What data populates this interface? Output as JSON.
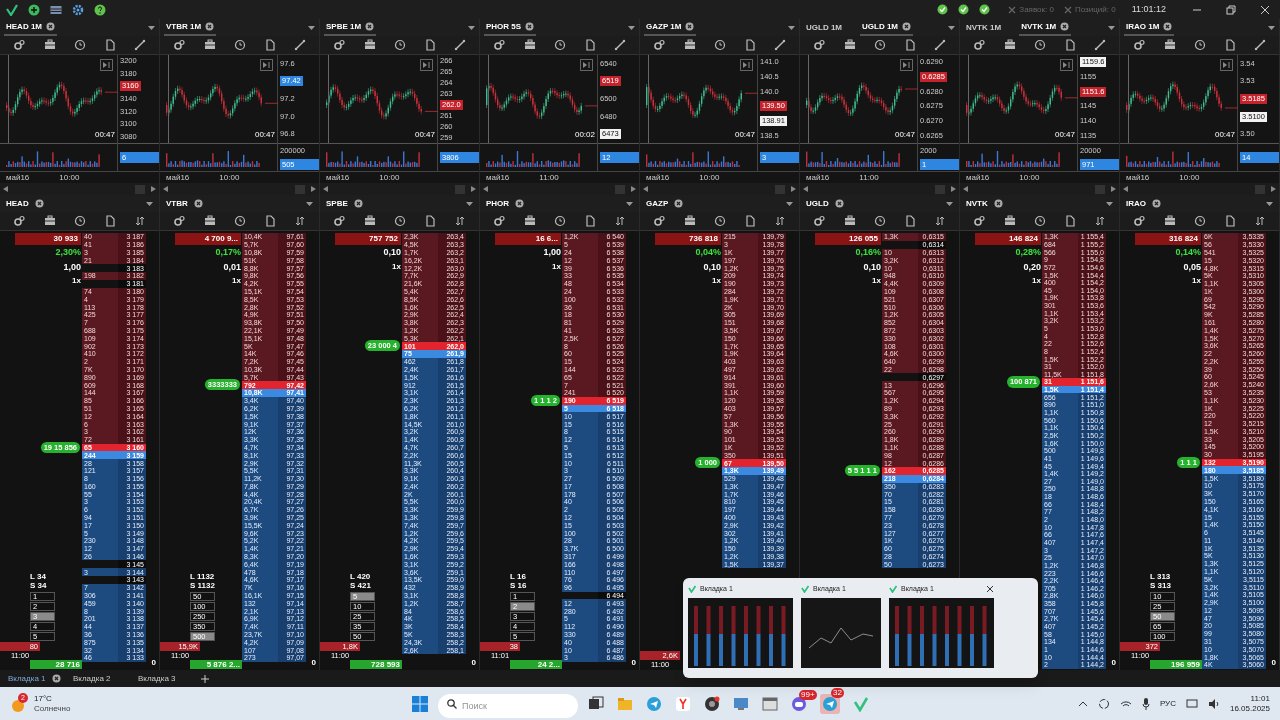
{
  "top_bar": {
    "orders": "Заявок: 0",
    "positions": "Позиций: 0",
    "clock": "11:01:12"
  },
  "chart_panels": [
    {
      "tabs": [
        {
          "label": "HEAD 1M",
          "selected": true
        }
      ],
      "axis": [
        {
          "text": "3200",
          "kind": "tick"
        },
        {
          "text": "3180",
          "kind": "tick"
        },
        {
          "text": "3160",
          "kind": "last"
        },
        {
          "text": "3140",
          "kind": "tick"
        },
        {
          "text": "3120",
          "kind": "tick"
        },
        {
          "text": "3100",
          "kind": "tick"
        },
        {
          "text": "3080",
          "kind": "tick"
        }
      ],
      "timer": "00:47",
      "volume_tag": "6",
      "x_labels": [
        "май16",
        "10:00"
      ]
    },
    {
      "tabs": [
        {
          "label": "VTBR 1M",
          "selected": true
        }
      ],
      "axis": [
        {
          "text": "97.6",
          "kind": "tick"
        },
        {
          "text": "97.42",
          "kind": "bid"
        },
        {
          "text": "97.2",
          "kind": "tick"
        },
        {
          "text": "97.0",
          "kind": "tick"
        },
        {
          "text": "96.8",
          "kind": "tick"
        }
      ],
      "timer": "00:47",
      "volume_tick": "200000",
      "volume_tag": "505",
      "x_labels": [
        "май16",
        "10:00"
      ]
    },
    {
      "tabs": [
        {
          "label": "SPBE 1M",
          "selected": true
        }
      ],
      "axis": [
        {
          "text": "266",
          "kind": "tick"
        },
        {
          "text": "265",
          "kind": "tick"
        },
        {
          "text": "264",
          "kind": "tick"
        },
        {
          "text": "263",
          "kind": "tick"
        },
        {
          "text": "262.0",
          "kind": "last"
        },
        {
          "text": "261",
          "kind": "tick"
        },
        {
          "text": "260",
          "kind": "tick"
        },
        {
          "text": "259",
          "kind": "tick"
        }
      ],
      "timer": "00:47",
      "volume_tag": "3806",
      "x_labels": [
        "май16",
        "10:00"
      ]
    },
    {
      "tabs": [
        {
          "label": "PHOR 5S",
          "selected": true
        }
      ],
      "axis": [
        {
          "text": "6540",
          "kind": "tick"
        },
        {
          "text": "6519",
          "kind": "last"
        },
        {
          "text": "6500",
          "kind": "tick"
        },
        {
          "text": "6480",
          "kind": "tick"
        },
        {
          "text": "6473",
          "kind": "level"
        }
      ],
      "timer": "00:02",
      "volume_tag": "12",
      "x_labels": [
        "май16",
        "11:00"
      ]
    },
    {
      "tabs": [
        {
          "label": "GAZP 1M",
          "selected": true
        }
      ],
      "axis": [
        {
          "text": "141.0",
          "kind": "tick"
        },
        {
          "text": "140.5",
          "kind": "tick"
        },
        {
          "text": "140.0",
          "kind": "tick"
        },
        {
          "text": "139.50",
          "kind": "last"
        },
        {
          "text": "138.91",
          "kind": "level"
        },
        {
          "text": "138.5",
          "kind": "tick"
        }
      ],
      "timer": "00:47",
      "volume_tag": "3",
      "x_labels": [
        "май16",
        "10:00"
      ]
    },
    {
      "tabs": [
        {
          "label": "UGLD 1M",
          "selected": false
        },
        {
          "label": "UGLD 1M",
          "selected": true
        }
      ],
      "axis": [
        {
          "text": "0.6290",
          "kind": "tick"
        },
        {
          "text": "0.6285",
          "kind": "last"
        },
        {
          "text": "0.6280",
          "kind": "tick"
        },
        {
          "text": "0.6275",
          "kind": "tick"
        },
        {
          "text": "0.6270",
          "kind": "tick"
        },
        {
          "text": "0.6265",
          "kind": "tick"
        }
      ],
      "timer": "00:47",
      "volume_tick": "2000",
      "volume_tag": "1",
      "x_labels": [
        "май16",
        "11:00"
      ]
    },
    {
      "tabs": [
        {
          "label": "NVTK 1M",
          "selected": false
        },
        {
          "label": "NVTK 1M",
          "selected": true
        }
      ],
      "axis": [
        {
          "text": "1159.6",
          "kind": "level"
        },
        {
          "text": "1155",
          "kind": "tick"
        },
        {
          "text": "1151.6",
          "kind": "last"
        },
        {
          "text": "1145",
          "kind": "tick"
        },
        {
          "text": "1140",
          "kind": "tick"
        },
        {
          "text": "1135",
          "kind": "tick"
        }
      ],
      "timer": "00:47",
      "volume_tick": "20000",
      "volume_tag": "971",
      "x_labels": [
        "май16",
        "10:00"
      ]
    },
    {
      "tabs": [
        {
          "label": "IRAO 1M",
          "selected": true
        }
      ],
      "axis": [
        {
          "text": "3.54",
          "kind": "tick"
        },
        {
          "text": "3.53",
          "kind": "tick"
        },
        {
          "text": "3.5185",
          "kind": "last"
        },
        {
          "text": "3.5100",
          "kind": "level"
        },
        {
          "text": "3.50",
          "kind": "tick"
        }
      ],
      "timer": "00:47",
      "volume_tag": "14",
      "x_labels": [
        "май16",
        "10:00"
      ]
    }
  ],
  "order_books": [
    {
      "ticker": "HEAD",
      "volume": "30 933",
      "change": "2,30%",
      "step": "1,00",
      "multiplier": "1x",
      "marker": "19 15 856",
      "asks": [
        [
          "40",
          "3 187"
        ],
        [
          "41",
          "3 186"
        ],
        [
          "3",
          "3 185"
        ],
        [
          "21",
          "3 184"
        ],
        [
          "3 183"
        ],
        [
          "198",
          "3 182"
        ],
        [
          "3 181"
        ],
        [
          "74",
          "3 180"
        ],
        [
          "4",
          "3 179"
        ],
        [
          "113",
          "3 178"
        ],
        [
          "425",
          "3 177"
        ],
        [
          "7",
          "3 176"
        ],
        [
          "688",
          "3 175"
        ],
        [
          "109",
          "3 174"
        ],
        [
          "902",
          "3 173"
        ],
        [
          "410",
          "3 172"
        ],
        [
          "2",
          "3 171"
        ],
        [
          "7K",
          "3 170"
        ],
        [
          "890",
          "3 169"
        ],
        [
          "609",
          "3 168"
        ],
        [
          "144",
          "3 167"
        ],
        [
          "85",
          "3 166"
        ],
        [
          "51",
          "3 165"
        ],
        [
          "12",
          "3 164"
        ],
        [
          "6",
          "3 163"
        ],
        [
          "3",
          "3 162"
        ],
        [
          "72",
          "3 161"
        ]
      ],
      "best_ask": [
        "65",
        "3 160"
      ],
      "best_bid": [
        "244",
        "3 159"
      ],
      "bids": [
        [
          "28",
          "3 158"
        ],
        [
          "121",
          "3 157"
        ],
        [
          "8",
          "3 156"
        ],
        [
          "160",
          "3 155"
        ],
        [
          "55",
          "3 154"
        ],
        [
          "3",
          "3 153"
        ],
        [
          "6",
          "3 152"
        ],
        [
          "94",
          "3 151"
        ],
        [
          "17",
          "3 150"
        ],
        [
          "5",
          "3 149"
        ],
        [
          "230",
          "3 148"
        ],
        [
          "12",
          "3 147"
        ],
        [
          "26",
          "3 146"
        ],
        [
          "3 145"
        ],
        [
          "3",
          "3 144"
        ],
        [
          "3 143"
        ],
        [
          "7",
          "3 142"
        ],
        [
          "306",
          "3 141"
        ],
        [
          "459",
          "3 140"
        ],
        [
          "8",
          "3 139"
        ],
        [
          "201",
          "3 138"
        ],
        [
          "44",
          "3 137"
        ],
        [
          "36",
          "3 136"
        ],
        [
          "875",
          "3 135"
        ],
        [
          "32",
          "3 134"
        ],
        [
          "46",
          "3 133"
        ]
      ],
      "bottom": {
        "long": "L 34",
        "short": "S 34",
        "lots": [
          {
            "label": "1",
            "selected": false
          },
          {
            "label": "2",
            "selected": false
          },
          {
            "label": "3",
            "selected": true
          },
          {
            "label": "4",
            "selected": false
          },
          {
            "label": "5",
            "selected": false
          }
        ],
        "sell_tag": "80",
        "time": "11:00",
        "total": "28 716"
      },
      "zero": "0"
    },
    {
      "ticker": "VTBR",
      "volume": "4 700 9...",
      "change": "0,17%",
      "step": "0,01",
      "multiplier": "1x",
      "marker": "3333333",
      "asks": [
        [
          "10,4K",
          "97,61"
        ],
        [
          "5,7K",
          "97,60"
        ],
        [
          "10,8K",
          "97,59"
        ],
        [
          "51K",
          "97,58"
        ],
        [
          "8,8K",
          "97,57"
        ],
        [
          "9,8K",
          "97,56"
        ],
        [
          "4,2K",
          "97,55"
        ],
        [
          "15,1K",
          "97,54"
        ],
        [
          "8,5K",
          "97,53"
        ],
        [
          "2,8K",
          "97,52"
        ],
        [
          "4,9K",
          "97,51"
        ],
        [
          "93,8K",
          "97,50"
        ],
        [
          "22,1K",
          "97,49"
        ],
        [
          "15,1K",
          "97,48"
        ],
        [
          "5K",
          "97,47"
        ],
        [
          "14K",
          "97,46"
        ],
        [
          "7,2K",
          "97,45"
        ],
        [
          "10,3K",
          "97,44"
        ],
        [
          "5,7K",
          "97,43"
        ]
      ],
      "best_ask": [
        "792",
        "97,42"
      ],
      "best_bid": [
        "10,8K",
        "97,41"
      ],
      "bids": [
        [
          "3,4K",
          "97,40"
        ],
        [
          "6,2K",
          "97,39"
        ],
        [
          "1,5K",
          "97,38"
        ],
        [
          "9,1K",
          "97,37"
        ],
        [
          "12K",
          "97,36"
        ],
        [
          "3,3K",
          "97,35"
        ],
        [
          "4,7K",
          "97,34"
        ],
        [
          "8,1K",
          "97,33"
        ],
        [
          "2,9K",
          "97,32"
        ],
        [
          "5,5K",
          "97,31"
        ],
        [
          "11,2K",
          "97,30"
        ],
        [
          "7,8K",
          "97,29"
        ],
        [
          "4,4K",
          "97,28"
        ],
        [
          "20,4K",
          "97,27"
        ],
        [
          "6,7K",
          "97,26"
        ],
        [
          "3,9K",
          "97,25"
        ],
        [
          "15,5K",
          "97,24"
        ],
        [
          "9,6K",
          "97,23"
        ],
        [
          "5,2K",
          "97,22"
        ],
        [
          "1,4K",
          "97,21"
        ],
        [
          "8,3K",
          "97,20"
        ],
        [
          "6,4K",
          "97,19"
        ],
        [
          "478",
          "97,18"
        ],
        [
          "4,6K",
          "97,17"
        ],
        [
          "7K",
          "97,16"
        ],
        [
          "16,1K",
          "97,15"
        ],
        [
          "132",
          "97,14"
        ],
        [
          "2,1K",
          "97,13"
        ],
        [
          "6,9K",
          "97,12"
        ],
        [
          "7,4K",
          "97,11"
        ],
        [
          "23,7K",
          "97,10"
        ],
        [
          "4,2K",
          "97,09"
        ],
        [
          "107",
          "97,08"
        ],
        [
          "273",
          "97,07"
        ]
      ],
      "bottom": {
        "long": "L 1132",
        "short": "S 1132",
        "lots": [
          {
            "label": "50",
            "selected": false
          },
          {
            "label": "100",
            "selected": false
          },
          {
            "label": "250",
            "selected": false
          },
          {
            "label": "350",
            "selected": false
          },
          {
            "label": "500",
            "selected": true
          }
        ],
        "sell_tag": "15,9K",
        "time": "11:00",
        "total": "5 876 2..."
      },
      "zero": "0"
    },
    {
      "ticker": "SPBE",
      "volume": "757 752",
      "step": "0,10",
      "multiplier": "1x",
      "marker": "23 000 4",
      "asks": [
        [
          "2,3K",
          "263,4"
        ],
        [
          "4,5K",
          "263,3"
        ],
        [
          "1,7K",
          "263,2"
        ],
        [
          "16,2K",
          "263,1"
        ],
        [
          "12,2K",
          "263,0"
        ],
        [
          "7,7K",
          "262,9"
        ],
        [
          "21,6K",
          "262,8"
        ],
        [
          "5,4K",
          "262,7"
        ],
        [
          "8,5K",
          "262,6"
        ],
        [
          "1,6K",
          "262,5"
        ],
        [
          "2,9K",
          "262,4"
        ],
        [
          "3,8K",
          "262,3"
        ],
        [
          "1,2K",
          "262,2"
        ],
        [
          "5,3K",
          "262,1"
        ]
      ],
      "best_ask": [
        "101",
        "262,0"
      ],
      "best_bid": [
        "75",
        "261,9"
      ],
      "bids": [
        [
          "462",
          "261,8"
        ],
        [
          "2,4K",
          "261,7"
        ],
        [
          "1,5K",
          "261,6"
        ],
        [
          "912",
          "261,5"
        ],
        [
          "3,1K",
          "261,4"
        ],
        [
          "2,3K",
          "261,3"
        ],
        [
          "6,2K",
          "261,2"
        ],
        [
          "1,8K",
          "261,1"
        ],
        [
          "14,5K",
          "261,0"
        ],
        [
          "3,2K",
          "260,9"
        ],
        [
          "1,4K",
          "260,8"
        ],
        [
          "4,7K",
          "260,7"
        ],
        [
          "2,2K",
          "260,6"
        ],
        [
          "11,3K",
          "260,5"
        ],
        [
          "3,3K",
          "260,4"
        ],
        [
          "9,1K",
          "260,3"
        ],
        [
          "2,4K",
          "260,2"
        ],
        [
          "2K",
          "260,1"
        ],
        [
          "5,5K",
          "260,0"
        ],
        [
          "3,3K",
          "259,9"
        ],
        [
          "1,3K",
          "259,8"
        ],
        [
          "7,4K",
          "259,7"
        ],
        [
          "1,2K",
          "259,6"
        ],
        [
          "4,2K",
          "259,5"
        ],
        [
          "2,9K",
          "259,4"
        ],
        [
          "1,6K",
          "259,3"
        ],
        [
          "3,1K",
          "259,2"
        ],
        [
          "3,6K",
          "259,1"
        ],
        [
          "13,5K",
          "259,0"
        ],
        [
          "432",
          "258,9"
        ],
        [
          "3,1K",
          "258,8"
        ],
        [
          "1,2K",
          "258,7"
        ],
        [
          "84",
          "258,6"
        ],
        [
          "4K",
          "258,5"
        ],
        [
          "3K",
          "258,4"
        ],
        [
          "5K",
          "258,3"
        ],
        [
          "24,3K",
          "258,2"
        ],
        [
          "2,6K",
          "258,1"
        ]
      ],
      "bottom": {
        "long": "L 420",
        "short": "S 421",
        "lots": [
          {
            "label": "5",
            "selected": true
          },
          {
            "label": "10",
            "selected": false
          },
          {
            "label": "25",
            "selected": false
          },
          {
            "label": "35",
            "selected": false
          },
          {
            "label": "50",
            "selected": false
          }
        ],
        "sell_tag": "1,8K",
        "time": "11:00",
        "total": "728 593"
      },
      "zero": "0"
    },
    {
      "ticker": "PHOR",
      "volume": "16 6...",
      "step": "1,00",
      "multiplier": "1x",
      "marker": "1 1 1 2",
      "asks": [
        [
          "1,2K",
          "6 540"
        ],
        [
          "5",
          "6 539"
        ],
        [
          "24",
          "6 538"
        ],
        [
          "12",
          "6 537"
        ],
        [
          "39",
          "6 536"
        ],
        [
          "33",
          "6 535"
        ],
        [
          "48",
          "6 534"
        ],
        [
          "24",
          "6 533"
        ],
        [
          "100",
          "6 532"
        ],
        [
          "36",
          "6 531"
        ],
        [
          "18",
          "6 530"
        ],
        [
          "81",
          "6 529"
        ],
        [
          "41",
          "6 528"
        ],
        [
          "2,5K",
          "6 527"
        ],
        [
          "8",
          "6 526"
        ],
        [
          "60",
          "6 525"
        ],
        [
          "15",
          "6 524"
        ],
        [
          "144",
          "6 523"
        ],
        [
          "65",
          "6 522"
        ],
        [
          "7",
          "6 521"
        ],
        [
          "241",
          "6 520"
        ]
      ],
      "best_ask": [
        "190",
        "6 519"
      ],
      "best_bid": [
        "5",
        "6 518"
      ],
      "bids": [
        [
          "10",
          "6 517"
        ],
        [
          "15",
          "6 516"
        ],
        [
          "8",
          "6 515"
        ],
        [
          "12",
          "6 514"
        ],
        [
          "5",
          "6 513"
        ],
        [
          "15",
          "6 512"
        ],
        [
          "10",
          "6 511"
        ],
        [
          "3",
          "6 510"
        ],
        [
          "27",
          "6 509"
        ],
        [
          "17",
          "6 508"
        ],
        [
          "178",
          "6 507"
        ],
        [
          "40",
          "6 506"
        ],
        [
          "2",
          "6 505"
        ],
        [
          "12",
          "6 504"
        ],
        [
          "15",
          "6 503"
        ],
        [
          "100",
          "6 502"
        ],
        [
          "28",
          "6 501"
        ],
        [
          "3,7K",
          "6 500"
        ],
        [
          "317",
          "6 499"
        ],
        [
          "166",
          "6 498"
        ],
        [
          "110",
          "6 497"
        ],
        [
          "76",
          "6 496"
        ],
        [
          "96",
          "6 495"
        ],
        [
          "6 494"
        ],
        [
          "12",
          "6 493"
        ],
        [
          "280",
          "6 492"
        ],
        [
          "5",
          "6 491"
        ],
        [
          "112",
          "6 490"
        ],
        [
          "330",
          "6 489"
        ],
        [
          "40",
          "6 488"
        ],
        [
          "10",
          "6 487"
        ],
        [
          "3",
          "6 486"
        ]
      ],
      "bottom": {
        "long": "L 16",
        "short": "S 16",
        "lots": [
          {
            "label": "1",
            "selected": false
          },
          {
            "label": "2",
            "selected": true
          },
          {
            "label": "3",
            "selected": false
          },
          {
            "label": "4",
            "selected": false
          },
          {
            "label": "5",
            "selected": false
          }
        ],
        "sell_tag": "38",
        "time": "11:01",
        "total": "24 2..."
      },
      "zero": "0"
    },
    {
      "ticker": "GAZP",
      "volume": "736 818",
      "change": "0,04%",
      "step": "0,10",
      "multiplier": "1x",
      "marker": "1 000",
      "asks": [
        [
          "215",
          "139,79"
        ],
        [
          "3",
          "139,78"
        ],
        [
          "1K",
          "139,77"
        ],
        [
          "197",
          "139,76"
        ],
        [
          "1,2K",
          "139,75"
        ],
        [
          "209",
          "139,74"
        ],
        [
          "190",
          "139,73"
        ],
        [
          "284",
          "139,72"
        ],
        [
          "1,9K",
          "139,71"
        ],
        [
          "2K",
          "139,70"
        ],
        [
          "305",
          "139,69"
        ],
        [
          "151",
          "139,68"
        ],
        [
          "3,5K",
          "139,67"
        ],
        [
          "150",
          "139,66"
        ],
        [
          "1,7K",
          "139,65"
        ],
        [
          "1,9K",
          "139,64"
        ],
        [
          "403",
          "139,63"
        ],
        [
          "497",
          "139,62"
        ],
        [
          "914",
          "139,61"
        ],
        [
          "391",
          "139,60"
        ],
        [
          "1,1K",
          "139,59"
        ],
        [
          "120",
          "139,58"
        ],
        [
          "403",
          "139,57"
        ],
        [
          "57",
          "139,56"
        ],
        [
          "1,3K",
          "139,55"
        ],
        [
          "90",
          "139,54"
        ],
        [
          "101",
          "139,53"
        ],
        [
          "1K",
          "139,52"
        ],
        [
          "350",
          "139,51"
        ]
      ],
      "best_ask": [
        "67",
        "139,50"
      ],
      "best_bid": [
        "1,3K",
        "139,49"
      ],
      "bids": [
        [
          "529",
          "139,48"
        ],
        [
          "1,3K",
          "139,47"
        ],
        [
          "1,7K",
          "139,46"
        ],
        [
          "810",
          "139,45"
        ],
        [
          "197",
          "139,44"
        ],
        [
          "400",
          "139,43"
        ],
        [
          "2,9K",
          "139,42"
        ],
        [
          "302",
          "139,41"
        ],
        [
          "1,2K",
          "139,40"
        ],
        [
          "150",
          "139,39"
        ],
        [
          "1,2K",
          "139,38"
        ],
        [
          "1,5K",
          "139,37"
        ]
      ],
      "bottom": {
        "sell_tag": "2,6K",
        "time": "11:00"
      }
    },
    {
      "ticker": "UGLD",
      "volume": "126 055",
      "change": "0,16%",
      "step": "0,10",
      "multiplier": "1x",
      "marker": "5 5 1 1 1",
      "asks": [
        [
          "1,3K",
          "0,6315"
        ],
        [
          "0,6314"
        ],
        [
          "10",
          "0,6313"
        ],
        [
          "3,2K",
          "0,6312"
        ],
        [
          "10",
          "0,6311"
        ],
        [
          "948",
          "0,6310"
        ],
        [
          "4,4K",
          "0,6309"
        ],
        [
          "109",
          "0,6308"
        ],
        [
          "521",
          "0,6307"
        ],
        [
          "510",
          "0,6306"
        ],
        [
          "1,2K",
          "0,6305"
        ],
        [
          "852",
          "0,6304"
        ],
        [
          "872",
          "0,6303"
        ],
        [
          "330",
          "0,6302"
        ],
        [
          "108",
          "0,6301"
        ],
        [
          "4,6K",
          "0,6300"
        ],
        [
          "640",
          "0,6299"
        ],
        [
          "22",
          "0,6298"
        ],
        [
          "0,6297"
        ],
        [
          "13",
          "0,6296"
        ],
        [
          "567",
          "0,6295"
        ],
        [
          "1,2K",
          "0,6294"
        ],
        [
          "89",
          "0,6293"
        ],
        [
          "3,3K",
          "0,6292"
        ],
        [
          "25",
          "0,6291"
        ],
        [
          "260",
          "0,6290"
        ],
        [
          "1,8K",
          "0,6289"
        ],
        [
          "1,1K",
          "0,6288"
        ],
        [
          "98",
          "0,6287"
        ],
        [
          "12",
          "0,6286"
        ]
      ],
      "best_ask": [
        "162",
        "0,6285"
      ],
      "best_bid": [
        "218",
        "0,6284"
      ],
      "bids": [
        [
          "350",
          "0,6283"
        ],
        [
          "70",
          "0,6282"
        ],
        [
          "15",
          "0,6281"
        ],
        [
          "158",
          "0,6280"
        ],
        [
          "77",
          "0,6279"
        ],
        [
          "23",
          "0,6278"
        ],
        [
          "127",
          "0,6277"
        ],
        [
          "1K",
          "0,6276"
        ],
        [
          "60",
          "0,6275"
        ],
        [
          "28",
          "0,6274"
        ],
        [
          "50",
          "0,6273"
        ]
      ]
    },
    {
      "ticker": "NVTK",
      "volume": "146 824",
      "change": "0,28%",
      "step": "0,20",
      "multiplier": "1x",
      "marker": "100 871",
      "asks": [
        [
          "1,3K",
          "1 155,4"
        ],
        [
          "684",
          "1 155,2"
        ],
        [
          "566",
          "1 155,0"
        ],
        [
          "9",
          "1 154,8"
        ],
        [
          "572",
          "1 154,6"
        ],
        [
          "1,5K",
          "1 154,4"
        ],
        [
          "400",
          "1 154,2"
        ],
        [
          "45",
          "1 154,0"
        ],
        [
          "1,9K",
          "1 153,8"
        ],
        [
          "301",
          "1 153,6"
        ],
        [
          "1,1K",
          "1 153,4"
        ],
        [
          "3,2K",
          "1 153,2"
        ],
        [
          "5",
          "1 153,0"
        ],
        [
          "4",
          "1 152,8"
        ],
        [
          "22",
          "1 152,6"
        ],
        [
          "8",
          "1 152,4"
        ],
        [
          "1,5K",
          "1 152,2"
        ],
        [
          "31",
          "1 152,0"
        ],
        [
          "11,5K",
          "1 151,8"
        ]
      ],
      "best_ask": [
        "31",
        "1 151,6"
      ],
      "best_bid": [
        "1,5K",
        "1 151,4"
      ],
      "bids": [
        [
          "656",
          "1 151,2"
        ],
        [
          "890",
          "1 151,0"
        ],
        [
          "1,1K",
          "1 150,8"
        ],
        [
          "560",
          "1 150,6"
        ],
        [
          "1,1K",
          "1 150,4"
        ],
        [
          "2,5K",
          "1 150,2"
        ],
        [
          "1,6K",
          "1 150,0"
        ],
        [
          "500",
          "1 149,8"
        ],
        [
          "41",
          "1 149,6"
        ],
        [
          "45",
          "1 149,4"
        ],
        [
          "1,4K",
          "1 149,2"
        ],
        [
          "27",
          "1 149,0"
        ],
        [
          "250",
          "1 148,8"
        ],
        [
          "18",
          "1 148,6"
        ],
        [
          "66",
          "1 148,4"
        ],
        [
          "77",
          "1 148,2"
        ],
        [
          "2",
          "1 148,0"
        ],
        [
          "10",
          "1 147,8"
        ],
        [
          "66",
          "1 147,6"
        ],
        [
          "407",
          "1 147,4"
        ],
        [
          "3",
          "1 147,2"
        ],
        [
          "25",
          "1 147,0"
        ],
        [
          "1,2K",
          "1 146,8"
        ],
        [
          "223",
          "1 146,6"
        ],
        [
          "2,2K",
          "1 146,4"
        ],
        [
          "705",
          "1 146,2"
        ],
        [
          "2,8K",
          "1 146,0"
        ],
        [
          "358",
          "1 145,8"
        ],
        [
          "707",
          "1 145,6"
        ],
        [
          "2,7K",
          "1 145,4"
        ],
        [
          "407",
          "1 145,2"
        ],
        [
          "58",
          "1 145,0"
        ],
        [
          "134",
          "1 144,8"
        ],
        [
          "1",
          "1 144,6"
        ],
        [
          "10",
          "1 144,4"
        ],
        [
          "2",
          "1 144,2"
        ]
      ],
      "zero": "0"
    },
    {
      "ticker": "IRAO",
      "volume": "316 824",
      "change": "0,14%",
      "step": "0,05",
      "multiplier": "1x",
      "marker": "1 1 1",
      "asks": [
        [
          "6K",
          "3,5335"
        ],
        [
          "56",
          "3,5330"
        ],
        [
          "541",
          "3,5325"
        ],
        [
          "15",
          "3,5320"
        ],
        [
          "4,8K",
          "3,5315"
        ],
        [
          "5K",
          "3,5310"
        ],
        [
          "1,1K",
          "3,5305"
        ],
        [
          "1K",
          "3,5300"
        ],
        [
          "69",
          "3,5295"
        ],
        [
          "542",
          "3,5290"
        ],
        [
          "9K",
          "3,5285"
        ],
        [
          "161",
          "3,5280"
        ],
        [
          "1,4K",
          "3,5275"
        ],
        [
          "1,5K",
          "3,5270"
        ],
        [
          "3,6K",
          "3,5265"
        ],
        [
          "22",
          "3,5260"
        ],
        [
          "2,2K",
          "3,5255"
        ],
        [
          "39",
          "3,5250"
        ],
        [
          "60",
          "3,5245"
        ],
        [
          "2,6K",
          "3,5240"
        ],
        [
          "53",
          "3,5235"
        ],
        [
          "1,1K",
          "3,5230"
        ],
        [
          "1K",
          "3,5225"
        ],
        [
          "220",
          "3,5220"
        ],
        [
          "12",
          "3,5215"
        ],
        [
          "1,5K",
          "3,5210"
        ],
        [
          "33",
          "3,5205"
        ],
        [
          "145",
          "3,5200"
        ],
        [
          "30",
          "3,5195"
        ]
      ],
      "best_ask": [
        "132",
        "3,5190"
      ],
      "best_bid": [
        "180",
        "3,5185"
      ],
      "bids": [
        [
          "1,5K",
          "3,5180"
        ],
        [
          "10",
          "3,5175"
        ],
        [
          "3K",
          "3,5170"
        ],
        [
          "150",
          "3,5165"
        ],
        [
          "4,1K",
          "3,5160"
        ],
        [
          "15",
          "3,5155"
        ],
        [
          "1,4K",
          "3,5150"
        ],
        [
          "6",
          "3,5145"
        ],
        [
          "11",
          "3,5140"
        ],
        [
          "1K",
          "3,5135"
        ],
        [
          "5K",
          "3,5130"
        ],
        [
          "1,3K",
          "3,5125"
        ],
        [
          "1,1K",
          "3,5120"
        ],
        [
          "5K",
          "3,5115"
        ],
        [
          "3,2K",
          "3,5110"
        ],
        [
          "1,4K",
          "3,5105"
        ],
        [
          "2,9K",
          "3,5100"
        ],
        [
          "12",
          "3,5095"
        ],
        [
          "47",
          "3,5090"
        ],
        [
          "20",
          "3,5085"
        ],
        [
          "99",
          "3,5080"
        ],
        [
          "31",
          "3,5075"
        ],
        [
          "10",
          "3,5070"
        ],
        [
          "1,8K",
          "3,5065"
        ],
        [
          "4K",
          "3,5060"
        ]
      ],
      "bottom": {
        "long": "L 313",
        "short": "S 313",
        "lots": [
          {
            "label": "10",
            "selected": false
          },
          {
            "label": "25",
            "selected": false
          },
          {
            "label": "50",
            "selected": true
          },
          {
            "label": "65",
            "selected": false
          },
          {
            "label": "100",
            "selected": false
          }
        ],
        "sell_tag": "372",
        "time": "11:00",
        "total": "196 959"
      },
      "zero": "0"
    }
  ],
  "workspace_tabs": [
    {
      "label": "Вкладка 1",
      "selected": true
    },
    {
      "label": "Вкладка 2",
      "selected": false
    },
    {
      "label": "Вкладка 3",
      "selected": false
    }
  ],
  "window_previews": [
    {
      "title": "Вкладка 1"
    },
    {
      "title": "Вкладка 1"
    },
    {
      "title": "Вкладка 1"
    }
  ],
  "taskbar": {
    "weather_badge": "2",
    "temperature": "17°C",
    "weather": "Солнечно",
    "search_placeholder": "Поиск",
    "badges": [
      "99+",
      "32"
    ],
    "language": "РУС",
    "time": "11:01",
    "date": "16.05.2025"
  }
}
